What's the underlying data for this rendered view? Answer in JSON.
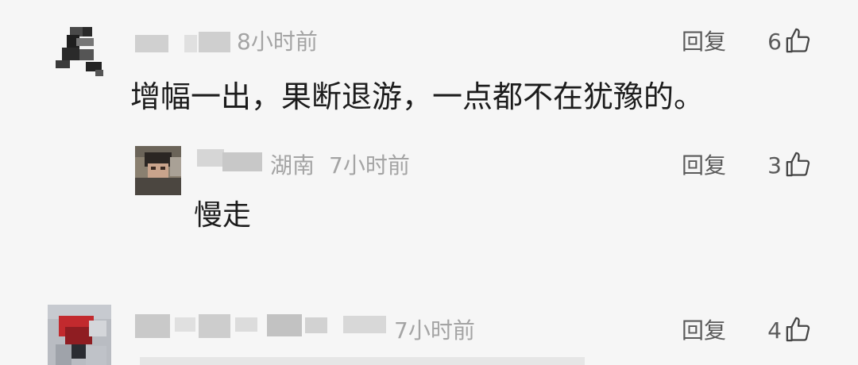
{
  "comments": [
    {
      "location": "",
      "time": "8小时前",
      "text": "增幅一出，果断退游，一点都不在犹豫的。",
      "reply_label": "回复",
      "likes": "6"
    },
    {
      "location": "湖南",
      "time": "7小时前",
      "text": "慢走",
      "reply_label": "回复",
      "likes": "3"
    },
    {
      "location": "",
      "time": "7小时前",
      "text": "",
      "reply_label": "回复",
      "likes": "4"
    }
  ],
  "icons": {
    "like": "thumbs-up-icon"
  }
}
